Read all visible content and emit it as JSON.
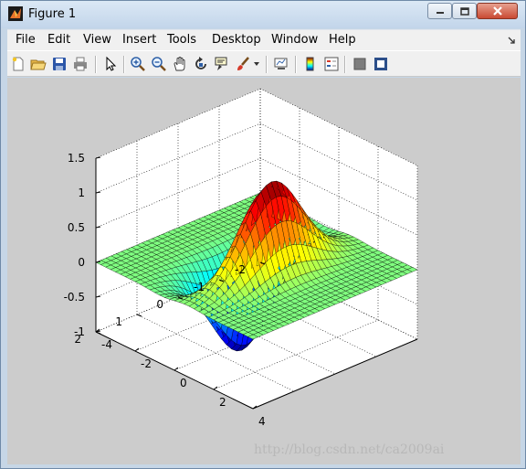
{
  "window": {
    "title": "Figure 1",
    "icon": "matlab-icon"
  },
  "menu": [
    "File",
    "Edit",
    "View",
    "Insert",
    "Tools",
    "Desktop",
    "Window",
    "Help"
  ],
  "toolbar_icons": [
    "new-figure-icon",
    "open-file-icon",
    "save-icon",
    "print-icon",
    "edit-plot-arrow-icon",
    "zoom-in-icon",
    "zoom-out-icon",
    "pan-hand-icon",
    "rotate-3d-icon",
    "data-cursor-icon",
    "brush-icon",
    "brush-dropdown-icon",
    "link-plot-icon",
    "insert-colorbar-icon",
    "insert-legend-icon",
    "hide-plot-tools-icon",
    "show-plot-tools-icon"
  ],
  "axes": {
    "z_ticks": [
      "1.5",
      "1",
      "0.5",
      "0",
      "-0.5",
      "-1"
    ],
    "y_ticks": [
      "2",
      "1",
      "0",
      "-1",
      "-2"
    ],
    "x_ticks": [
      "-4",
      "-2",
      "0",
      "2",
      "4"
    ]
  },
  "chart_data": {
    "type": "surface",
    "function": "z = x * exp(-x^2 - y^2)",
    "x_range": [
      -4,
      4
    ],
    "y_range": [
      -2,
      2
    ],
    "z_range": [
      -1,
      1.5
    ],
    "colormap": "jet",
    "grid": true
  },
  "watermark": "http://blog.csdn.net/ca2009ai"
}
